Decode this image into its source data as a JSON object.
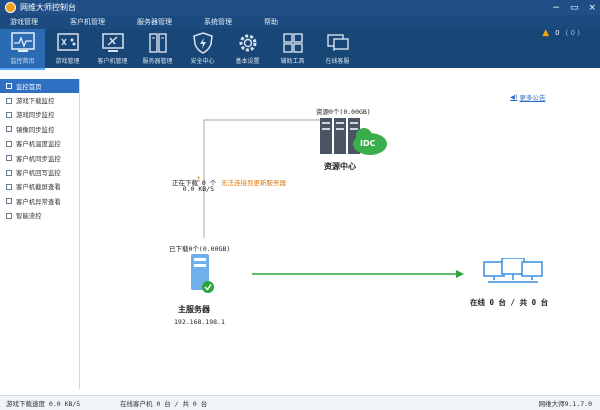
{
  "window": {
    "title": "网维大师控制台",
    "controls": [
      "−",
      "▭",
      "×"
    ]
  },
  "menu": [
    "游戏管理",
    "客户机管理",
    "服务器管理",
    "系统管理",
    "帮助"
  ],
  "toolbar": [
    {
      "label": "监控首页",
      "icon": "monitor-icon",
      "active": true
    },
    {
      "label": "游戏管理",
      "icon": "gamepad-icon",
      "active": false
    },
    {
      "label": "客户机管理",
      "icon": "client-tools-icon",
      "active": false
    },
    {
      "label": "服务器管理",
      "icon": "server-icon",
      "active": false
    },
    {
      "label": "安全中心",
      "icon": "shield-icon",
      "active": false
    },
    {
      "label": "基本设置",
      "icon": "gear-icon",
      "active": false
    },
    {
      "label": "辅助工具",
      "icon": "tools-grid-icon",
      "active": false
    },
    {
      "label": "在线客服",
      "icon": "chat-icon",
      "active": false
    }
  ],
  "toolbar_right": {
    "warning_count": "0",
    "info_text": "( 0 )"
  },
  "sidebar": [
    "监控首页",
    "游戏下载监控",
    "游戏同步监控",
    "镜像同步监控",
    "客户机温度监控",
    "客户机同步监控",
    "客户机回写监控",
    "客户机截屏查看",
    "客户机异常查看",
    "智能流控"
  ],
  "notice": "更多公告",
  "resource_center": {
    "label": "资源中心",
    "caption": "资源0个(0.00GB)",
    "badge": "IDC"
  },
  "link_status": {
    "downloading": "正在下载 0 个",
    "speed": "0.0 KB/S",
    "error": "无法连接到更新服务器"
  },
  "main_server": {
    "label": "主服务器",
    "ip": "192.168.198.1",
    "downloaded": "已下载0个(0.00GB)"
  },
  "clients": {
    "summary": "在线 0 台 / 共 0 台"
  },
  "status": {
    "download_speed": "游戏下载速度 0.0 KB/S",
    "online_clients": "在线客户机 0 台 / 共 0 台",
    "version": "网维大师9.1.7.0"
  },
  "colors": {
    "titlebar": "#1f4f86",
    "toolbar": "#174677",
    "accent": "#2e6fc4",
    "flow_arrow": "#2aa63a",
    "error_text": "#e07a10"
  }
}
